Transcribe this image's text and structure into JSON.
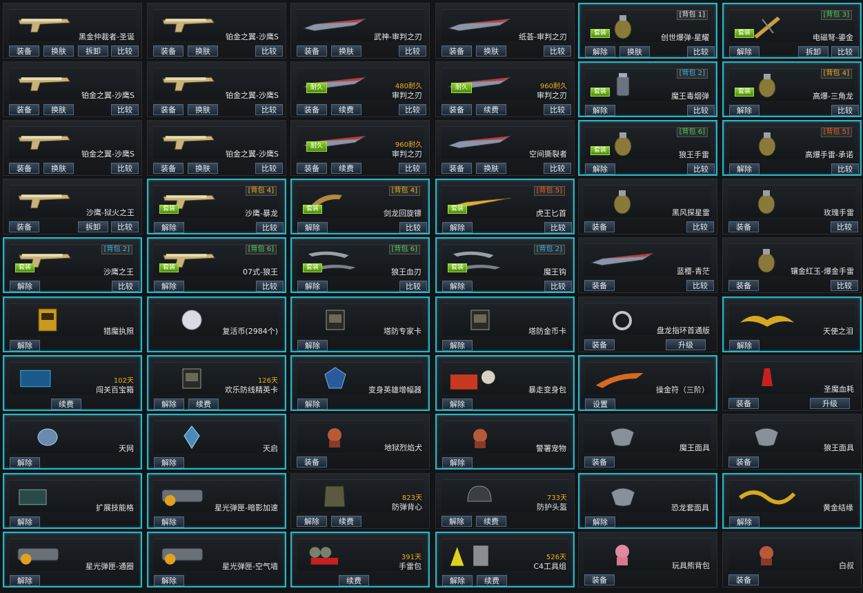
{
  "colors": {
    "accent": "#2ab7c9",
    "duration": "#f0b020",
    "bag_blue": "#39b7e6",
    "bag_green": "#4ed05a",
    "bag_yellow": "#f0b020",
    "bag_red": "#f06020"
  },
  "items": [
    {
      "name": "黑金仲裁者-圣诞",
      "icon": "pistol-icon",
      "buttons": [
        "装备",
        "换肤",
        "拆卸",
        "比较"
      ],
      "layout": "four"
    },
    {
      "name": "铂金之翼-沙鹰S",
      "icon": "pistol-icon",
      "buttons": [
        "装备",
        "换肤",
        "比较"
      ],
      "layout": "three"
    },
    {
      "name": "武神-审判之刃",
      "icon": "blade-icon",
      "buttons": [
        "装备",
        "换肤",
        "比较"
      ],
      "layout": "three"
    },
    {
      "name": "纸荟-审判之刃",
      "icon": "blade-icon",
      "buttons": [
        "装备",
        "换肤",
        "比较"
      ],
      "layout": "three"
    },
    {
      "name": "创世爆弹-星耀",
      "icon": "grenade-icon",
      "tag": "[背包 1]",
      "tagcolor": "#e8e8e8",
      "badge": "套装",
      "buttons": [
        "解除",
        "换肤",
        "比较"
      ],
      "layout": "three",
      "hl": true
    },
    {
      "name": "电磁弩-鎏金",
      "icon": "crossbow-icon",
      "tag": "[背包 3]",
      "tagcolor": "#4ed05a",
      "badge": "套装",
      "buttons": [
        "解除",
        "拆卸",
        "比较"
      ],
      "layout": "three-right",
      "hl": true
    },
    {
      "name": "铂金之翼-沙鹰S",
      "icon": "pistol-icon",
      "buttons": [
        "装备",
        "换肤",
        "比较"
      ],
      "layout": "three"
    },
    {
      "name": "铂金之翼-沙鹰S",
      "icon": "pistol-icon",
      "buttons": [
        "装备",
        "换肤",
        "比较"
      ],
      "layout": "three"
    },
    {
      "name": "审判之刃",
      "icon": "blade-icon",
      "dur": "480耐久",
      "durbadge": "耐久",
      "buttons": [
        "装备",
        "续费",
        "比较"
      ],
      "layout": "three"
    },
    {
      "name": "审判之刃",
      "icon": "blade-icon",
      "dur": "960耐久",
      "durbadge": "耐久",
      "buttons": [
        "装备",
        "续费",
        "比较"
      ],
      "layout": "three"
    },
    {
      "name": "魔王毒烟弹",
      "icon": "smoke-grenade-icon",
      "tag": "[背包 2]",
      "tagcolor": "#39b7e6",
      "badge": "套装",
      "buttons": [
        "解除",
        "比较"
      ],
      "layout": "two-right",
      "hl": true
    },
    {
      "name": "高爆-三角龙",
      "icon": "grenade-icon",
      "tag": "[背包 4]",
      "tagcolor": "#f0b020",
      "badge": "套装",
      "buttons": [
        "解除",
        "比较"
      ],
      "layout": "two-right",
      "hl": true
    },
    {
      "name": "铂金之翼-沙鹰S",
      "icon": "pistol-icon",
      "buttons": [
        "装备",
        "换肤",
        "比较"
      ],
      "layout": "three"
    },
    {
      "name": "铂金之翼-沙鹰S",
      "icon": "pistol-icon",
      "buttons": [
        "装备",
        "换肤",
        "比较"
      ],
      "layout": "three"
    },
    {
      "name": "审判之刃",
      "icon": "blade-icon",
      "dur": "960耐久",
      "durbadge": "耐久",
      "buttons": [
        "装备",
        "续费",
        "比较"
      ],
      "layout": "three"
    },
    {
      "name": "空间撕裂者",
      "icon": "blade-icon",
      "buttons": [
        "装备",
        "换肤",
        "比较"
      ],
      "layout": "three"
    },
    {
      "name": "狼王手雷",
      "icon": "grenade-icon",
      "tag": "[背包 6]",
      "tagcolor": "#4ed05a",
      "badge": "套装",
      "buttons": [
        "解除",
        "比较"
      ],
      "layout": "two-right",
      "hl": true
    },
    {
      "name": "高爆手雷-承诺",
      "icon": "grenade-icon",
      "tag": "[背包 5]",
      "tagcolor": "#f06020",
      "badge": "",
      "buttons": [
        "解除",
        "比较"
      ],
      "layout": "two-right",
      "hl": true
    },
    {
      "name": "沙鹰-狱火之王",
      "icon": "pistol-icon",
      "buttons": [
        "装备",
        "拆卸",
        "比较"
      ],
      "layout": "three-right"
    },
    {
      "name": "沙鹰-暴龙",
      "icon": "pistol-icon",
      "tag": "[背包 4]",
      "tagcolor": "#f0b020",
      "badge": "套装",
      "buttons": [
        "解除",
        "比较"
      ],
      "layout": "two-right",
      "hl": true
    },
    {
      "name": "剑龙回旋镖",
      "icon": "boomerang-icon",
      "tag": "[背包 4]",
      "tagcolor": "#f0b020",
      "badge": "套装",
      "buttons": [
        "解除",
        "比较"
      ],
      "layout": "two-right",
      "hl": true
    },
    {
      "name": "虎王匕首",
      "icon": "dagger-icon",
      "tag": "[背包 5]",
      "tagcolor": "#f06020",
      "badge": "套装",
      "buttons": [
        "解除",
        "比较"
      ],
      "layout": "two-right",
      "hl": true
    },
    {
      "name": "黑风探星雷",
      "icon": "grenade-icon",
      "buttons": [
        "装备",
        "比较"
      ],
      "layout": "two-right"
    },
    {
      "name": "玫瑰手雷",
      "icon": "grenade-icon",
      "buttons": [
        "装备",
        "比较"
      ],
      "layout": "two-right"
    },
    {
      "name": "沙鹰之王",
      "icon": "pistol-icon",
      "tag": "[背包 2]",
      "tagcolor": "#39b7e6",
      "badge": "套装",
      "buttons": [
        "解除",
        "比较"
      ],
      "layout": "two-right",
      "hl": true
    },
    {
      "name": "07式-狼王",
      "icon": "pistol-icon",
      "tag": "[背包 6]",
      "tagcolor": "#4ed05a",
      "badge": "套装",
      "buttons": [
        "解除",
        "比较"
      ],
      "layout": "two-right",
      "hl": true
    },
    {
      "name": "狼王血刃",
      "icon": "claw-icon",
      "tag": "[背包 6]",
      "tagcolor": "#4ed05a",
      "badge": "套装",
      "buttons": [
        "解除",
        "比较"
      ],
      "layout": "two-right",
      "hl": true
    },
    {
      "name": "魔王钩",
      "icon": "claw-icon",
      "tag": "[背包 2]",
      "tagcolor": "#39b7e6",
      "badge": "套装",
      "buttons": [
        "解除",
        "比较"
      ],
      "layout": "two-right",
      "hl": true
    },
    {
      "name": "蓝樱-青茫",
      "icon": "blade-icon",
      "buttons": [
        "装备",
        "比较"
      ],
      "layout": "two-right"
    },
    {
      "name": "镶金红玉-爆金手雷",
      "icon": "grenade-icon",
      "buttons": [
        "装备",
        "比较"
      ],
      "layout": "two-right"
    },
    {
      "name": "猎魔执照",
      "icon": "license-icon",
      "buttons": [
        "解除"
      ],
      "layout": "one",
      "hl": true
    },
    {
      "name": "复活币(2984个)",
      "icon": "coin-icon",
      "buttons": [],
      "layout": "none",
      "hl": true
    },
    {
      "name": "塔防专家卡",
      "icon": "card-icon",
      "buttons": [
        "解除"
      ],
      "layout": "one",
      "hl": true
    },
    {
      "name": "塔防金币卡",
      "icon": "card-icon",
      "buttons": [
        "解除"
      ],
      "layout": "one",
      "hl": true
    },
    {
      "name": "盘龙指环首通版",
      "icon": "ring-icon",
      "buttons": [
        "装备",
        "升级"
      ],
      "layout": "two-mid"
    },
    {
      "name": "天使之泪",
      "icon": "wings-icon",
      "buttons": [
        "解除"
      ],
      "layout": "one",
      "hl": true
    },
    {
      "name": "闯关百宝箱",
      "icon": "box-icon",
      "dur": "102天",
      "buttons": [
        "续费"
      ],
      "layout": "one-center",
      "hl": true
    },
    {
      "name": "欢乐防线精英卡",
      "icon": "card-icon",
      "dur": "126天",
      "buttons": [
        "解除",
        "续费"
      ],
      "layout": "two-left",
      "hl": true
    },
    {
      "name": "变身英雄增幅器",
      "icon": "gem-icon",
      "buttons": [
        "解除"
      ],
      "layout": "one",
      "hl": true
    },
    {
      "name": "暴走变身包",
      "icon": "pack-icon",
      "buttons": [
        "解除"
      ],
      "layout": "one",
      "hl": true
    },
    {
      "name": "操金符（三阶）",
      "icon": "talisman-icon",
      "buttons": [
        "设置"
      ],
      "layout": "one",
      "hl": true
    },
    {
      "name": "圣魔血耗",
      "icon": "potion-icon",
      "buttons": [
        "装备",
        "升级"
      ],
      "layout": "two-mid"
    },
    {
      "name": "天网",
      "icon": "drone-icon",
      "buttons": [
        "解除"
      ],
      "layout": "one",
      "hl": true
    },
    {
      "name": "天启",
      "icon": "crystal-icon",
      "buttons": [
        "解除"
      ],
      "layout": "one",
      "hl": true
    },
    {
      "name": "地狱烈焰犬",
      "icon": "pet-icon",
      "buttons": [
        "装备"
      ],
      "layout": "one"
    },
    {
      "name": "警署宠物",
      "icon": "pet-icon",
      "buttons": [
        "解除"
      ],
      "layout": "one",
      "hl": true
    },
    {
      "name": "魔王面具",
      "icon": "mask-icon",
      "buttons": [
        "装备"
      ],
      "layout": "one"
    },
    {
      "name": "狼王面具",
      "icon": "mask-icon",
      "buttons": [
        "装备"
      ],
      "layout": "one"
    },
    {
      "name": "扩展技能格",
      "icon": "chip-icon",
      "buttons": [
        "解除"
      ],
      "layout": "one",
      "hl": true
    },
    {
      "name": "星光弹匣-暗影加速",
      "icon": "magazine-icon",
      "buttons": [
        "解除"
      ],
      "layout": "one",
      "hl": true
    },
    {
      "name": "防弹背心",
      "icon": "vest-icon",
      "dur": "823天",
      "buttons": [
        "解除",
        "续费"
      ],
      "layout": "two-left"
    },
    {
      "name": "防护头盔",
      "icon": "helmet-icon",
      "dur": "733天",
      "buttons": [
        "解除",
        "续费"
      ],
      "layout": "two-left"
    },
    {
      "name": "恐龙套面具",
      "icon": "mask-icon",
      "buttons": [
        "解除"
      ],
      "layout": "one",
      "hl": true
    },
    {
      "name": "黄金结缘",
      "icon": "ribbon-icon",
      "buttons": [
        "解除"
      ],
      "layout": "one",
      "hl": true
    },
    {
      "name": "星光弹匣-通圈",
      "icon": "magazine-icon",
      "buttons": [
        "解除"
      ],
      "layout": "one",
      "hl": true
    },
    {
      "name": "星光弹匣-空气墙",
      "icon": "magazine-icon",
      "buttons": [
        "解除"
      ],
      "layout": "one",
      "hl": true
    },
    {
      "name": "手雷包",
      "icon": "grenade-pack-icon",
      "dur": "391天",
      "buttons": [
        "续费"
      ],
      "layout": "one-center",
      "hl": true
    },
    {
      "name": "C4工具组",
      "icon": "c4-icon",
      "dur": "526天",
      "buttons": [
        "解除",
        "续费"
      ],
      "layout": "two-left",
      "hl": true
    },
    {
      "name": "玩具熊背包",
      "icon": "bear-icon",
      "buttons": [
        "装备"
      ],
      "layout": "one"
    },
    {
      "name": "白叔",
      "icon": "pet-icon",
      "buttons": [
        "装备"
      ],
      "layout": "one"
    }
  ]
}
